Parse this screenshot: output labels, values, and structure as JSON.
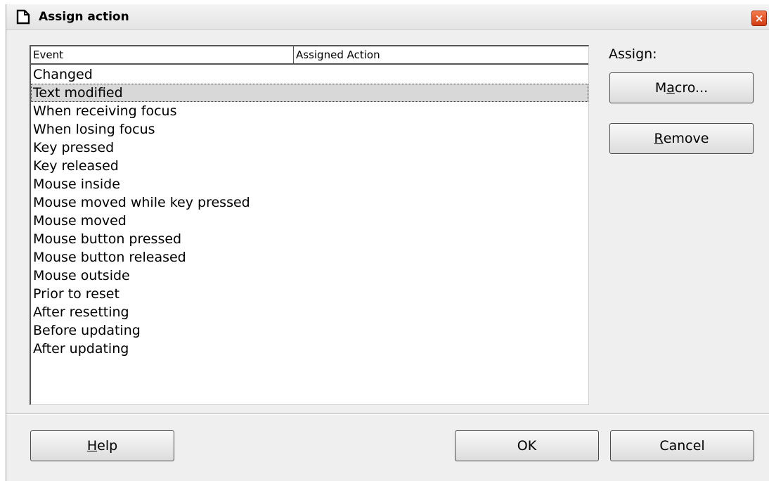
{
  "window": {
    "title": "Assign action",
    "close_glyph": "×"
  },
  "list": {
    "columns": [
      "Event",
      "Assigned Action"
    ],
    "events": [
      "Changed",
      "Text modified",
      "When receiving focus",
      "When losing focus",
      "Key pressed",
      "Key released",
      "Mouse inside",
      "Mouse moved while key pressed",
      "Mouse moved",
      "Mouse button pressed",
      "Mouse button released",
      "Mouse outside",
      "Prior to reset",
      "After resetting",
      "Before updating",
      "After updating"
    ],
    "selected_index": 1
  },
  "assign": {
    "label": "Assign:",
    "macro": {
      "prefix": "M",
      "mnemonic": "a",
      "suffix": "cro..."
    },
    "remove": {
      "prefix": "",
      "mnemonic": "R",
      "suffix": "emove"
    }
  },
  "footer": {
    "help": {
      "prefix": "",
      "mnemonic": "H",
      "suffix": "elp"
    },
    "ok": "OK",
    "cancel": "Cancel"
  },
  "colors": {
    "dialog_bg": "#efefef",
    "selection_bg": "#d8d8d8",
    "close_button": "#d13b12"
  },
  "icons": {
    "title": "document-icon",
    "close": "close-icon"
  }
}
